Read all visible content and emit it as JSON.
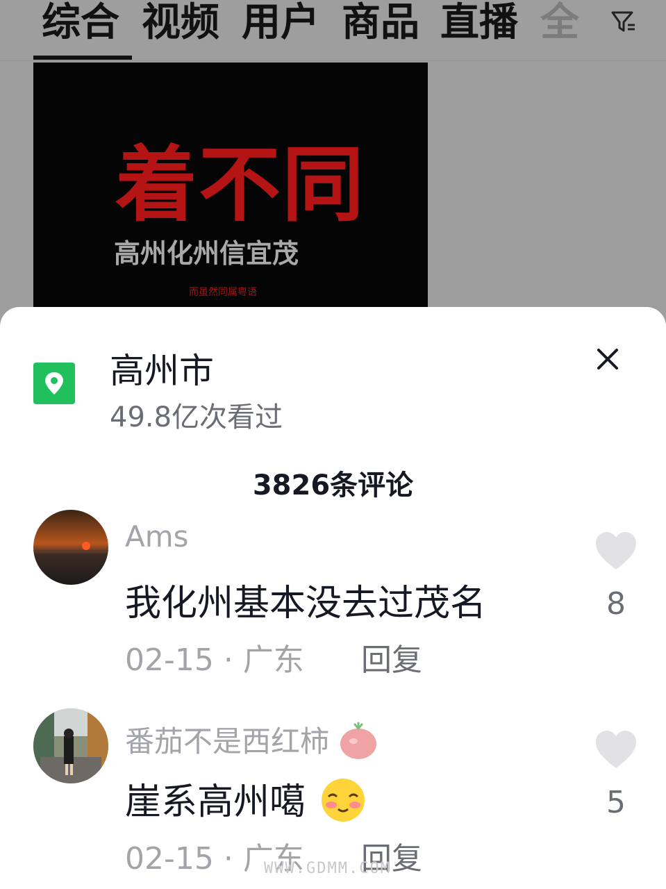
{
  "tabs": [
    {
      "label": "综合",
      "active": true
    },
    {
      "label": "视频"
    },
    {
      "label": "用户"
    },
    {
      "label": "商品"
    },
    {
      "label": "直播"
    },
    {
      "label": "全"
    }
  ],
  "thumbnail": {
    "big_text": "着不同",
    "sub_text": "高州化州信宜茂",
    "small_text": "而虽然同属粤语"
  },
  "location": {
    "name": "高州市",
    "views": "49.8亿次看过"
  },
  "comments_header": "3826条评论",
  "comments": [
    {
      "user": "Ams",
      "text": "我化州基本没去过茂名",
      "meta": "02-15 · 广东",
      "reply": "回复",
      "likes": "8"
    },
    {
      "user": "番茄不是西红柿",
      "text": "崖系高州噶",
      "meta": "02-15 · 广东",
      "reply": "回复",
      "likes": "5"
    }
  ],
  "watermark": "WWW.GDMM.COM",
  "colors": {
    "location_green": "#21c05c",
    "thumb_red": "#b41414"
  },
  "icons": [
    "filter-icon",
    "location-pin-icon",
    "close-icon",
    "heart-icon",
    "tomato-emoji-icon",
    "shy-smile-emoji-icon"
  ]
}
